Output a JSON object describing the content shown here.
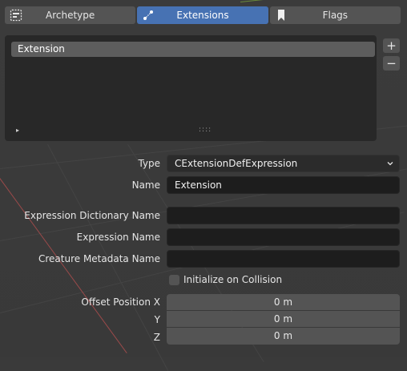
{
  "tabs": [
    {
      "label": "Archetype",
      "icon": "list-box-icon"
    },
    {
      "label": "Extensions",
      "icon": "node-link-icon"
    },
    {
      "label": "Flags",
      "icon": "bookmark-icon"
    }
  ],
  "active_tab": "Extensions",
  "extensions_list": {
    "items": [
      "Extension"
    ],
    "add_button": "+",
    "remove_button": "−",
    "expand_glyph": "▸",
    "grip_glyph": "::::"
  },
  "form": {
    "type_label": "Type",
    "type_value": "CExtensionDefExpression",
    "name_label": "Name",
    "name_value": "Extension",
    "expr_dict_label": "Expression Dictionary Name",
    "expr_dict_value": "",
    "expr_name_label": "Expression Name",
    "expr_name_value": "",
    "creature_meta_label": "Creature Metadata Name",
    "creature_meta_value": "",
    "init_collision_label": "Initialize on Collision",
    "init_collision_checked": false,
    "offset_label_x": "Offset Position X",
    "offset_label_y": "Y",
    "offset_label_z": "Z",
    "offset_x": "0 m",
    "offset_y": "0 m",
    "offset_z": "0 m"
  },
  "colors": {
    "accent": "#4772b3",
    "panel": "#282828",
    "field": "#1d1d1d",
    "button": "#545454"
  }
}
